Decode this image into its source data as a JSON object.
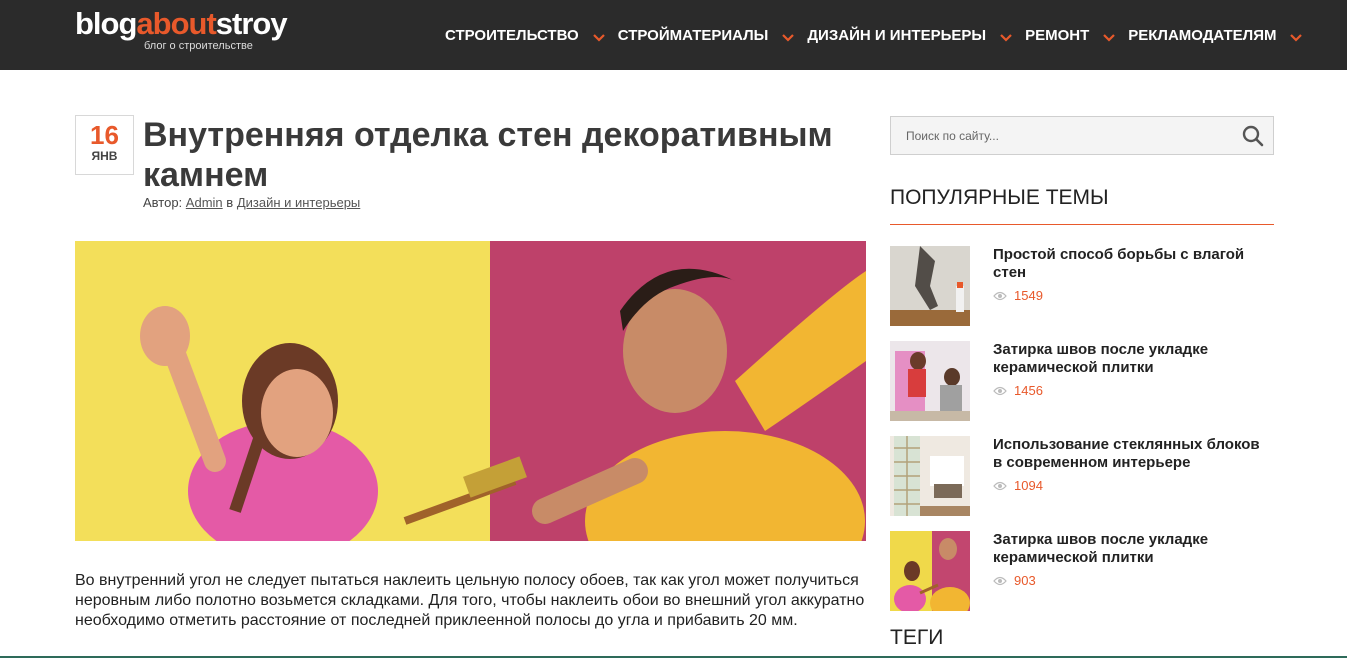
{
  "site": {
    "logo_part1": "blog",
    "logo_part2": "about",
    "logo_part3": "stroy",
    "tagline": "блог о строительстве"
  },
  "nav": [
    {
      "label": "Строительство"
    },
    {
      "label": "Стройматериалы"
    },
    {
      "label": "Дизайн и интерьеры"
    },
    {
      "label": "Ремонт"
    },
    {
      "label": "Рекламодателям"
    }
  ],
  "post": {
    "date_day": "16",
    "date_month": "янв",
    "title": "Внутренняя отделка стен декоративным камнем",
    "author_prefix": "Автор:",
    "author": "Admin",
    "category_prefix": "в",
    "category": "Дизайн и интерьеры",
    "text": "Во внутренний угол не следует пытаться наклеить цельную полосу обоев, так как угол может получиться неровным либо полотно возьмется складками. Для того, чтобы наклеить обои во внешний угол аккуратно необходимо отметить расстояние от последней приклеенной полосы до угла и прибавить 20 мм."
  },
  "search": {
    "placeholder": "Поиск по сайту..."
  },
  "popular": {
    "title": "Популярные темы",
    "items": [
      {
        "title": "Простой способ борьбы с влагой стен",
        "views": "1549"
      },
      {
        "title": "Затирка швов после укладке керамической плитки",
        "views": "1456"
      },
      {
        "title": "Использование стеклянных блоков в современном интерьере",
        "views": "1094"
      },
      {
        "title": "Затирка швов после укладке керамической плитки",
        "views": "903"
      }
    ]
  },
  "tags": {
    "title": "Теги"
  },
  "colors": {
    "accent": "#e8592b",
    "header_bg": "#2b2b2b"
  }
}
